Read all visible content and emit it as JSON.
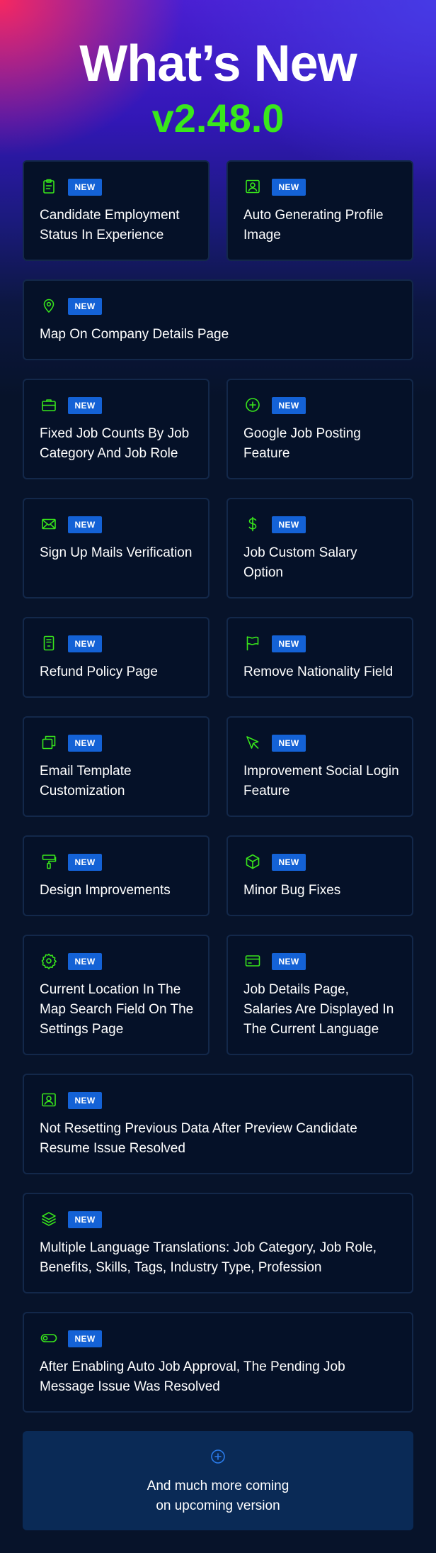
{
  "header": {
    "title": "What’s New",
    "version": "v2.48.0"
  },
  "badge_label": "NEW",
  "colors": {
    "accent_green": "#39e81c",
    "badge_blue": "#1462d6",
    "card_bg": "#051128",
    "card_border": "#13284a",
    "footer_bg": "#0a2a56"
  },
  "features": [
    {
      "icon": "clipboard-icon",
      "label": "Candidate Employment Status In Experience"
    },
    {
      "icon": "profile-image-icon",
      "label": "Auto Generating Profile Image"
    },
    {
      "icon": "map-pin-icon",
      "label": "Map On Company Details Page"
    },
    {
      "icon": "briefcase-icon",
      "label": "Fixed Job Counts By Job Category And Job Role"
    },
    {
      "icon": "plus-circle-icon",
      "label": "Google Job Posting Feature"
    },
    {
      "icon": "mail-icon",
      "label": "Sign Up Mails Verification"
    },
    {
      "icon": "dollar-icon",
      "label": "Job Custom Salary Option"
    },
    {
      "icon": "receipt-icon",
      "label": "Refund Policy Page"
    },
    {
      "icon": "flag-icon",
      "label": "Remove Nationality Field"
    },
    {
      "icon": "copy-icon",
      "label": "Email Template Customization"
    },
    {
      "icon": "cursor-icon",
      "label": "Improvement Social Login Feature"
    },
    {
      "icon": "paint-roller-icon",
      "label": "Design Improvements"
    },
    {
      "icon": "box-icon",
      "label": "Minor Bug Fixes"
    },
    {
      "icon": "gear-icon",
      "label": "Current Location In The Map Search Field On The Settings Page"
    },
    {
      "icon": "credit-card-icon",
      "label": "Job Details Page, Salaries Are Displayed In The Current Language"
    },
    {
      "icon": "profile-image-icon",
      "label": "Not Resetting Previous Data After Preview Candidate Resume Issue Resolved"
    },
    {
      "icon": "layers-icon",
      "label": "Multiple Language Translations: Job Category, Job Role, Benefits, Skills, Tags, Industry Type, Profession"
    },
    {
      "icon": "toggle-icon",
      "label": "After Enabling Auto Job Approval, The Pending Job Message Issue Was Resolved"
    }
  ],
  "footer": {
    "icon": "plus-circle-icon",
    "line1": "And much more coming",
    "line2": "on upcoming version"
  }
}
